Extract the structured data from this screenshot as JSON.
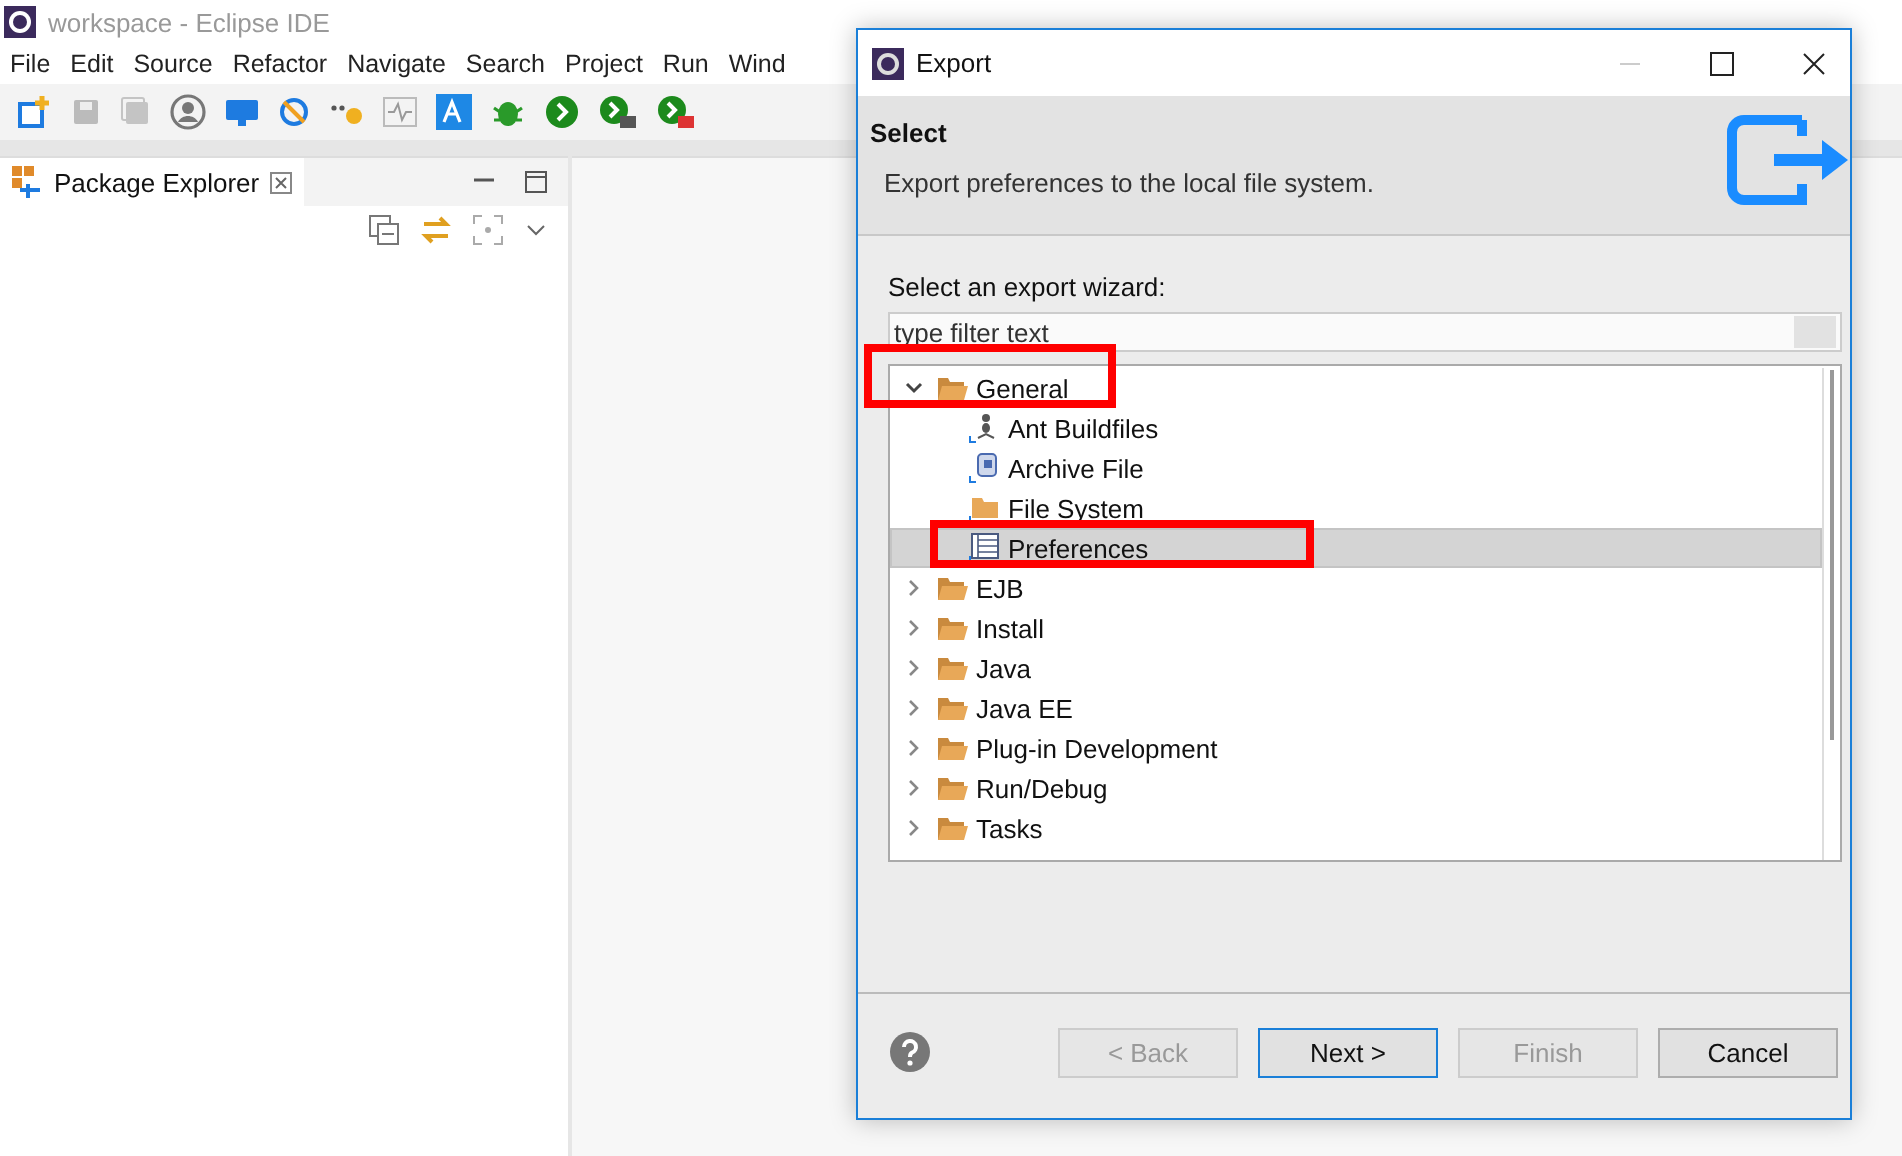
{
  "ide": {
    "title": "workspace - Eclipse IDE",
    "menu": [
      "File",
      "Edit",
      "Source",
      "Refactor",
      "Navigate",
      "Search",
      "Project",
      "Run",
      "Wind"
    ],
    "view_tab": {
      "label": "Package Explorer"
    }
  },
  "dialog": {
    "title": "Export",
    "header": {
      "title": "Select",
      "description": "Export preferences to the local file system."
    },
    "wizard_label": "Select an export wizard:",
    "filter": {
      "placeholder": "type filter text"
    },
    "tree": [
      {
        "label": "General",
        "expanded": true,
        "selected": false,
        "highlighted": true,
        "children": [
          {
            "label": "Ant Buildfiles",
            "kind": "ant",
            "selected": false,
            "highlighted": false
          },
          {
            "label": "Archive File",
            "kind": "archive",
            "selected": false,
            "highlighted": false
          },
          {
            "label": "File System",
            "kind": "folder",
            "selected": false,
            "highlighted": false
          },
          {
            "label": "Preferences",
            "kind": "preferences",
            "selected": true,
            "highlighted": true
          }
        ]
      },
      {
        "label": "EJB",
        "expanded": false,
        "selected": false,
        "highlighted": false
      },
      {
        "label": "Install",
        "expanded": false,
        "selected": false,
        "highlighted": false
      },
      {
        "label": "Java",
        "expanded": false,
        "selected": false,
        "highlighted": false
      },
      {
        "label": "Java EE",
        "expanded": false,
        "selected": false,
        "highlighted": false
      },
      {
        "label": "Plug-in Development",
        "expanded": false,
        "selected": false,
        "highlighted": false
      },
      {
        "label": "Run/Debug",
        "expanded": false,
        "selected": false,
        "highlighted": false
      },
      {
        "label": "Tasks",
        "expanded": false,
        "selected": false,
        "highlighted": false
      }
    ],
    "buttons": [
      {
        "label": "< Back",
        "disabled": true,
        "default": false
      },
      {
        "label": "Next >",
        "disabled": false,
        "default": true
      },
      {
        "label": "Finish",
        "disabled": true,
        "default": false
      },
      {
        "label": "Cancel",
        "disabled": false,
        "default": false
      }
    ]
  }
}
